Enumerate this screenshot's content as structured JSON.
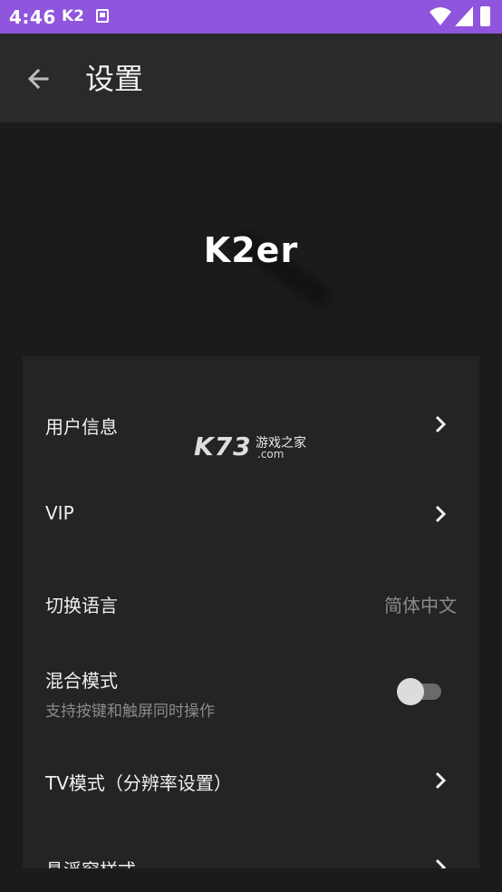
{
  "status_bar": {
    "time": "4:46",
    "app_indicator": "K2"
  },
  "header": {
    "title": "设置"
  },
  "logo": {
    "text": "K2er"
  },
  "settings": {
    "user_info": {
      "label": "用户信息"
    },
    "vip": {
      "label": "VIP"
    },
    "language": {
      "label": "切换语言",
      "value": "简体中文"
    },
    "mixed_mode": {
      "label": "混合模式",
      "subtitle": "支持按键和触屏同时操作",
      "enabled": false
    },
    "tv_mode": {
      "label": "TV模式（分辨率设置）"
    },
    "float_window": {
      "label": "悬浮窗样式"
    }
  },
  "watermark": {
    "main": "K73",
    "cn": "游戏之家",
    "domain": ".com"
  },
  "colors": {
    "status_bar": "#8f55dd",
    "background": "#1b1b1d",
    "app_bar": "#2a2a2c",
    "card": "#242425"
  }
}
